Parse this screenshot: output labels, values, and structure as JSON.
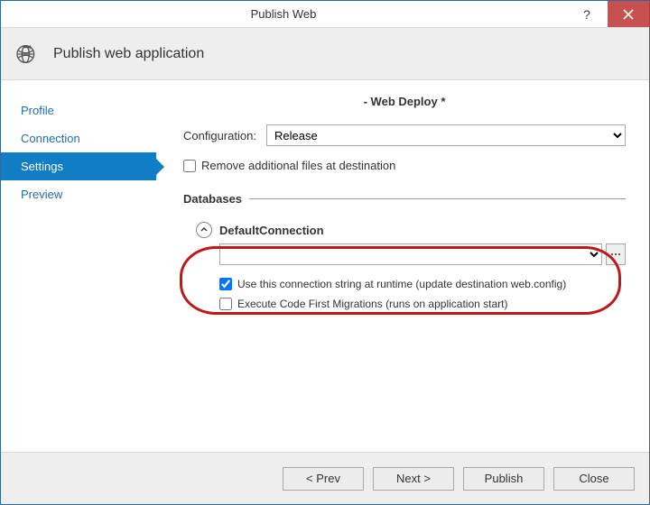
{
  "window": {
    "title": "Publish Web"
  },
  "header": {
    "title": "Publish web application"
  },
  "nav": {
    "items": [
      {
        "label": "Profile"
      },
      {
        "label": "Connection"
      },
      {
        "label": "Settings"
      },
      {
        "label": "Preview"
      }
    ],
    "activeIndex": 2
  },
  "main": {
    "method_title": "- Web Deploy *",
    "config_label": "Configuration:",
    "config_value": "Release",
    "remove_files_label": "Remove additional files at destination",
    "databases_heading": "Databases",
    "db": {
      "name": "DefaultConnection",
      "conn_value": "",
      "use_runtime_label": "Use this connection string at runtime (update destination web.config)",
      "migrations_label": "Execute Code First Migrations (runs on application start)"
    }
  },
  "footer": {
    "prev": "<  Prev",
    "next": "Next  >",
    "publish": "Publish",
    "close": "Close"
  }
}
